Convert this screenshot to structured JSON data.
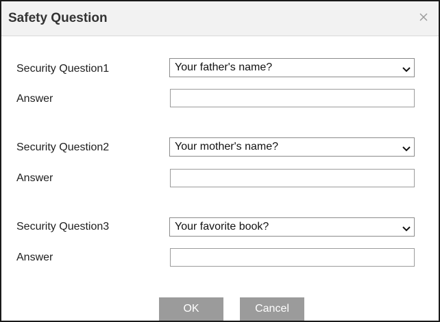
{
  "dialog": {
    "title": "Safety Question",
    "close_icon": "close-icon"
  },
  "questions": [
    {
      "label": "Security Question1",
      "selected": "Your father's name?",
      "answer_label": "Answer",
      "answer_value": ""
    },
    {
      "label": "Security Question2",
      "selected": "Your mother's name?",
      "answer_label": "Answer",
      "answer_value": ""
    },
    {
      "label": "Security Question3",
      "selected": "Your favorite book?",
      "answer_label": "Answer",
      "answer_value": ""
    }
  ],
  "buttons": {
    "ok_label": "OK",
    "cancel_label": "Cancel"
  },
  "colors": {
    "button_bg": "#9b9b9b",
    "title_bar_bg": "#f2f2f2"
  }
}
